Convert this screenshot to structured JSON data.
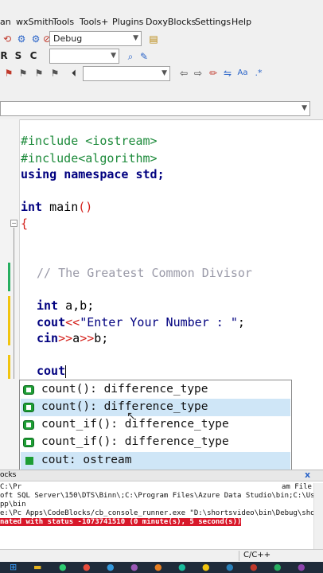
{
  "menu": [
    "an",
    "wxSmith",
    "Tools",
    "Tools+",
    "Plugins",
    "DoxyBlocks",
    "Settings",
    "Help"
  ],
  "toolbar": {
    "build_target": "Debug",
    "search_letters": [
      "R",
      "S",
      "C"
    ]
  },
  "code": {
    "line1": "#include <iostream>",
    "line2": "#include<algorithm>",
    "line3_kw1": "using",
    "line3_kw2": "namespace",
    "line3_rest": " std;",
    "line4_kw": "int",
    "line4_rest": " main",
    "line4_parens": "()",
    "line5_brace": "{",
    "comment": "// The Greatest Common Divisor",
    "decl_kw": "int",
    "decl_rest": " a,b;",
    "cout_kw": "cout",
    "cout_op": "<<",
    "cout_str": "\"Enter Your Number : \"",
    "cout_end": ";",
    "cin_kw": "cin",
    "cin_op1": ">>",
    "cin_a": "a",
    "cin_op2": ">>",
    "cin_b": "b;",
    "typing": "cout"
  },
  "autocomplete": [
    {
      "text": "count(): difference_type"
    },
    {
      "text": "count(): difference_type"
    },
    {
      "text": "count_if(): difference_type"
    },
    {
      "text": "count_if(): difference_type"
    },
    {
      "text": "cout: ostream"
    }
  ],
  "logs_tab": "ocks",
  "close_glyph": "x",
  "log_lines": [
    "C:\\Pr",
    "oft SQL Server\\150\\DTS\\Binn\\;C:\\Program Files\\Azure Data Studio\\bin;C:\\User",
    "pp\\bin",
    "e:\\Pc Apps\\CodeBlocks/cb_console_runner.exe \"D:\\shortsvideo\\bin\\Debug\\sho",
    "nated with status -1073741510 (0 minute(s), 5 second(s))"
  ],
  "log_right": "am File",
  "status_lang": "C/C++"
}
